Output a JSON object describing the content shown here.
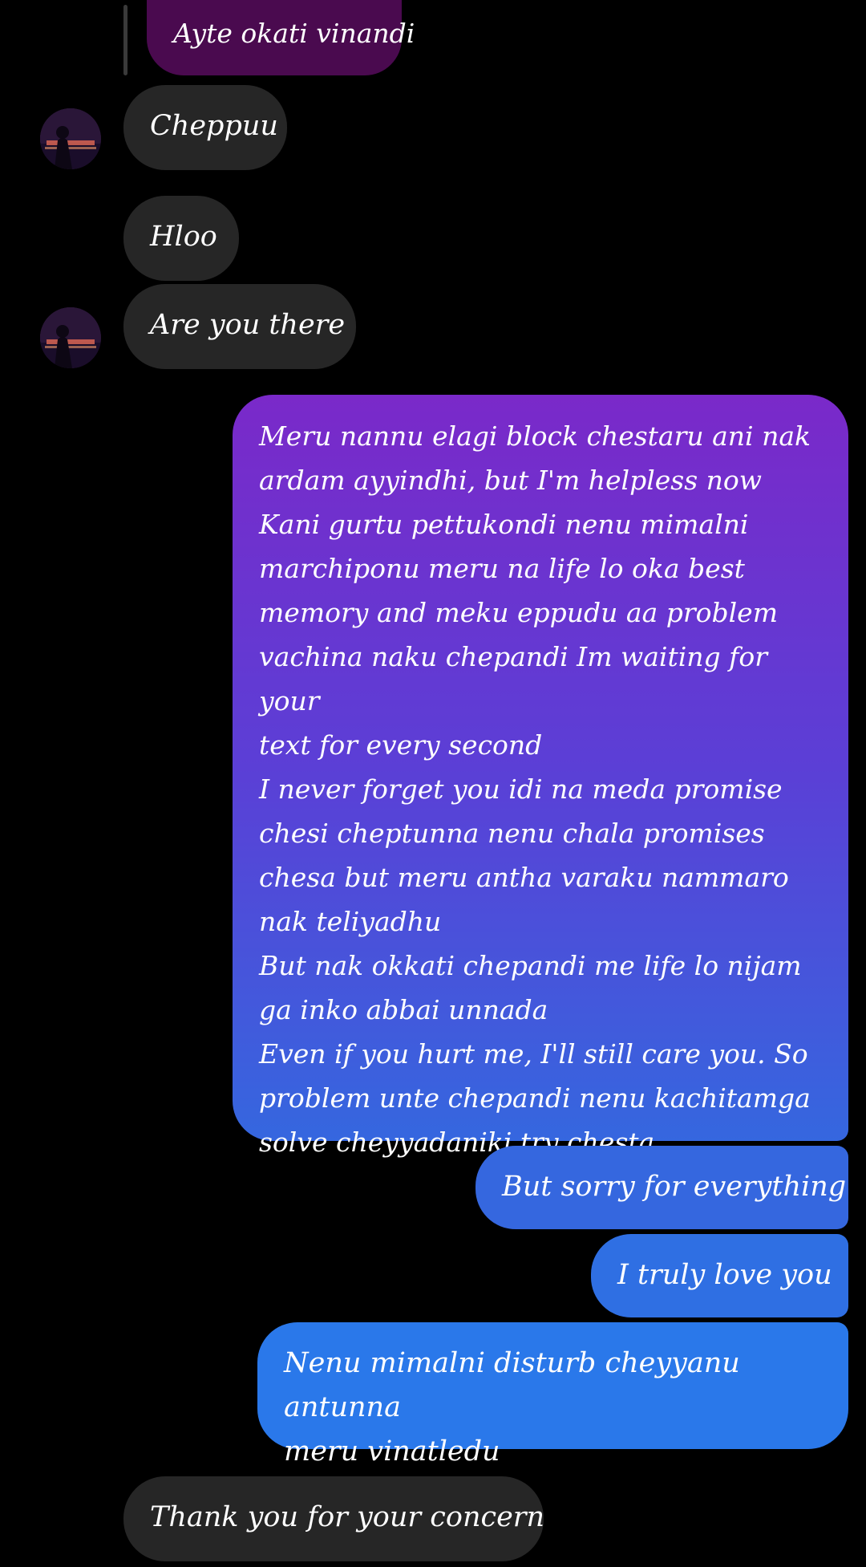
{
  "contact": {
    "avatar_icon": "profile-avatar"
  },
  "colors": {
    "incoming_bubble": "#262626",
    "reply_bubble": "#4a0a4f",
    "outgoing_gradient_top": "#7a29c9",
    "outgoing_gradient_bottom": "#3567df",
    "outgoing_blue": "#2f6fe3"
  },
  "messages": [
    {
      "id": "m0",
      "direction": "incoming",
      "style": "reply-quote",
      "text": "Ayte okati vinandi"
    },
    {
      "id": "m1",
      "direction": "incoming",
      "text": "Cheppuu",
      "avatar": true
    },
    {
      "id": "m2",
      "direction": "incoming",
      "text": "Hloo"
    },
    {
      "id": "m3",
      "direction": "incoming",
      "text": "Are you there",
      "avatar": true
    },
    {
      "id": "m4",
      "direction": "outgoing",
      "text": "Meru nannu elagi block chestaru ani nak\nardam ayyindhi, but I'm helpless now\nKani gurtu pettukondi nenu mimalni\nmarchiponu meru na life lo oka best\nmemory and meku eppudu aa problem\nvachina naku chepandi Im waiting for your\ntext for every second\nI never forget you idi na meda promise\nchesi cheptunna nenu chala promises\nchesa but meru antha varaku nammaro\nnak teliyadhu\nBut nak okkati chepandi me life lo nijam\nga inko abbai unnada\nEven if you hurt me, I'll still care you. So\nproblem unte chepandi nenu kachitamga\nsolve cheyyadaniki try chesta"
    },
    {
      "id": "m5",
      "direction": "outgoing",
      "text": "But sorry for everything"
    },
    {
      "id": "m6",
      "direction": "outgoing",
      "text": "I truly love you"
    },
    {
      "id": "m7",
      "direction": "outgoing",
      "text": "Nenu mimalni disturb cheyyanu antunna\nmeru vinatledu"
    },
    {
      "id": "m8",
      "direction": "incoming",
      "text": "Thank you for your concern"
    }
  ]
}
